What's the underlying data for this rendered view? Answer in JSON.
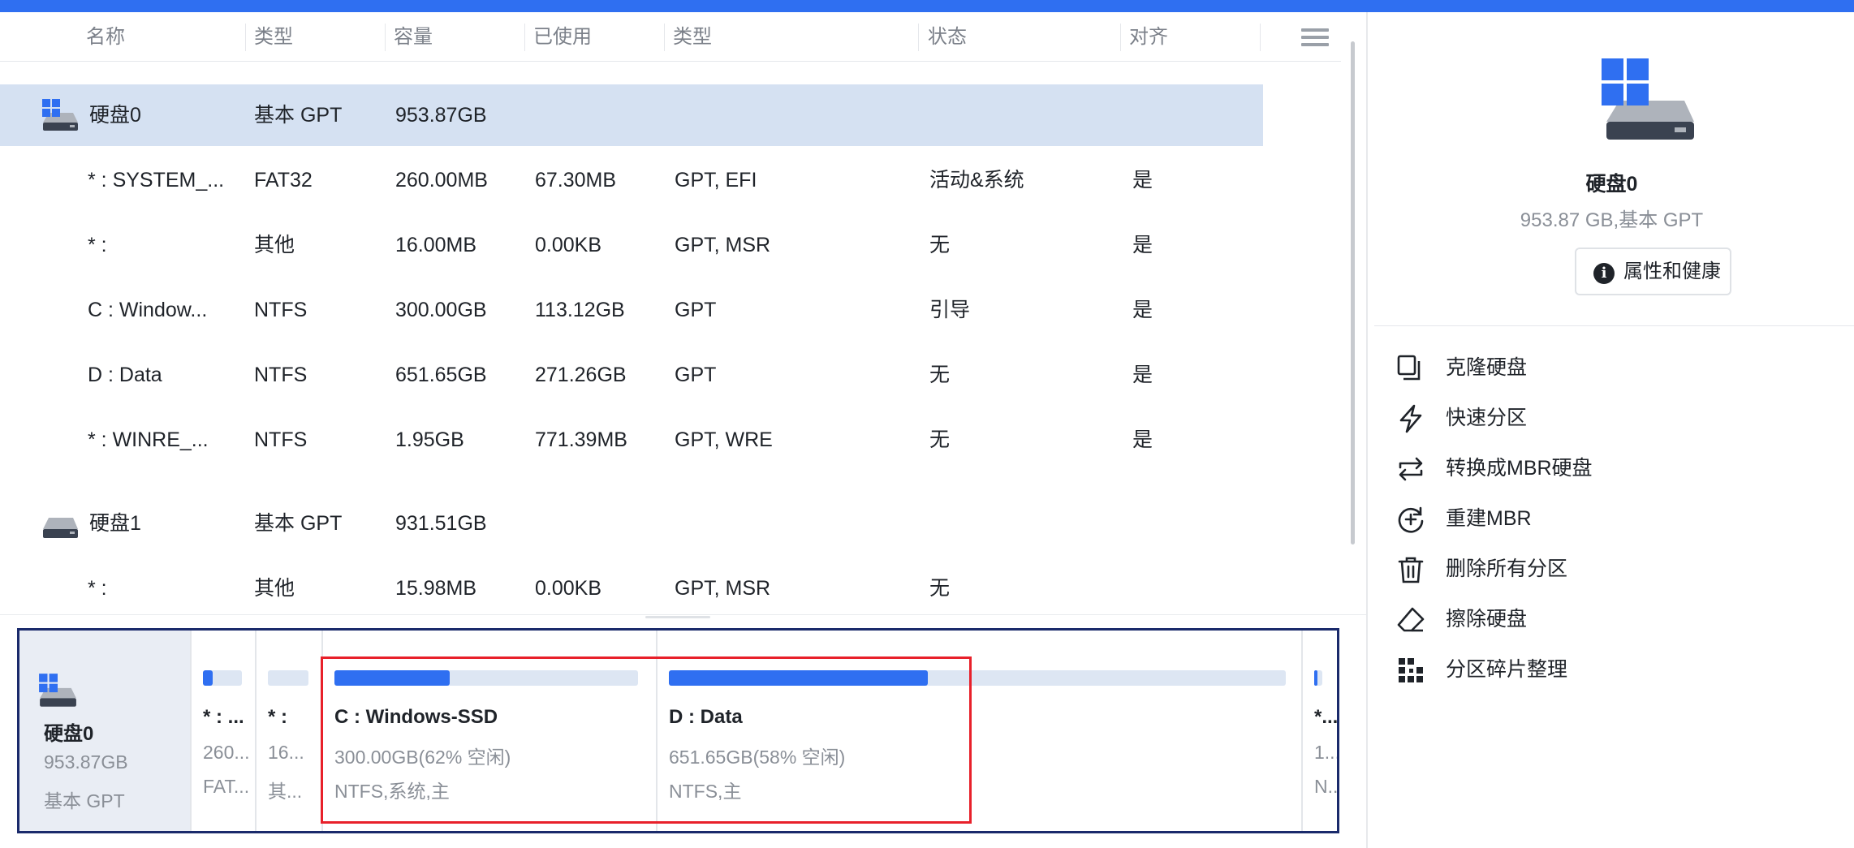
{
  "header": {
    "columns": [
      "名称",
      "类型",
      "容量",
      "已使用",
      "类型",
      "状态",
      "对齐"
    ]
  },
  "rows": [
    {
      "kind": "disk",
      "icon": "windows-disk-icon",
      "name": "硬盘0",
      "type": "基本 GPT",
      "capacity": "953.87GB",
      "used": "",
      "ptype": "",
      "status": "",
      "align": ""
    },
    {
      "kind": "part",
      "name": "* : SYSTEM_...",
      "type": "FAT32",
      "capacity": "260.00MB",
      "used": "67.30MB",
      "ptype": "GPT, EFI",
      "status": "活动&系统",
      "align": "是"
    },
    {
      "kind": "part",
      "name": "* :",
      "type": "其他",
      "capacity": "16.00MB",
      "used": "0.00KB",
      "ptype": "GPT, MSR",
      "status": "无",
      "align": "是"
    },
    {
      "kind": "part",
      "name": "C : Window...",
      "type": "NTFS",
      "capacity": "300.00GB",
      "used": "113.12GB",
      "ptype": "GPT",
      "status": "引导",
      "align": "是"
    },
    {
      "kind": "part",
      "name": "D : Data",
      "type": "NTFS",
      "capacity": "651.65GB",
      "used": "271.26GB",
      "ptype": "GPT",
      "status": "无",
      "align": "是"
    },
    {
      "kind": "part",
      "name": "* : WINRE_...",
      "type": "NTFS",
      "capacity": "1.95GB",
      "used": "771.39MB",
      "ptype": "GPT, WRE",
      "status": "无",
      "align": "是"
    },
    {
      "kind": "disk",
      "icon": "disk-icon",
      "name": "硬盘1",
      "type": "基本 GPT",
      "capacity": "931.51GB",
      "used": "",
      "ptype": "",
      "status": "",
      "align": ""
    },
    {
      "kind": "part",
      "name": "* :",
      "type": "其他",
      "capacity": "15.98MB",
      "used": "0.00KB",
      "ptype": "GPT, MSR",
      "status": "无",
      "align": ""
    }
  ],
  "diskmap": {
    "disk": {
      "name": "硬盘0",
      "size": "953.87GB",
      "type": "基本 GPT"
    },
    "segments": [
      {
        "name": "* : ...",
        "line2": "260...",
        "line3": "FAT...",
        "used_fraction": 0.26
      },
      {
        "name": "* :",
        "line2": "16...",
        "line3": "其...",
        "used_fraction": 0.0
      },
      {
        "name": "C : Windows-SSD",
        "line2": "300.00GB(62% 空闲)",
        "line3": "NTFS,系统,主",
        "used_fraction": 0.38
      },
      {
        "name": "D : Data",
        "line2": "651.65GB(58% 空闲)",
        "line3": "NTFS,主",
        "used_fraction": 0.42
      },
      {
        "name": "*...",
        "line2": "1...",
        "line3": "N...",
        "used_fraction": 0.4
      }
    ]
  },
  "right": {
    "disk_title": "硬盘0",
    "disk_sub": "953.87 GB,基本 GPT",
    "properties_button": "属性和健康",
    "actions": [
      {
        "label": "克隆硬盘",
        "icon": "clone-disk-icon"
      },
      {
        "label": "快速分区",
        "icon": "lightning-icon"
      },
      {
        "label": "转换成MBR硬盘",
        "icon": "convert-arrows-icon"
      },
      {
        "label": "重建MBR",
        "icon": "rebuild-plus-icon"
      },
      {
        "label": "删除所有分区",
        "icon": "trash-icon"
      },
      {
        "label": "擦除硬盘",
        "icon": "eraser-icon"
      },
      {
        "label": "分区碎片整理",
        "icon": "defrag-dots-icon"
      }
    ]
  },
  "colors": {
    "accent": "#2f6ff1",
    "selected_row": "#d5e1f2",
    "highlight_box": "#e8202a",
    "map_border": "#1a2a6b"
  }
}
